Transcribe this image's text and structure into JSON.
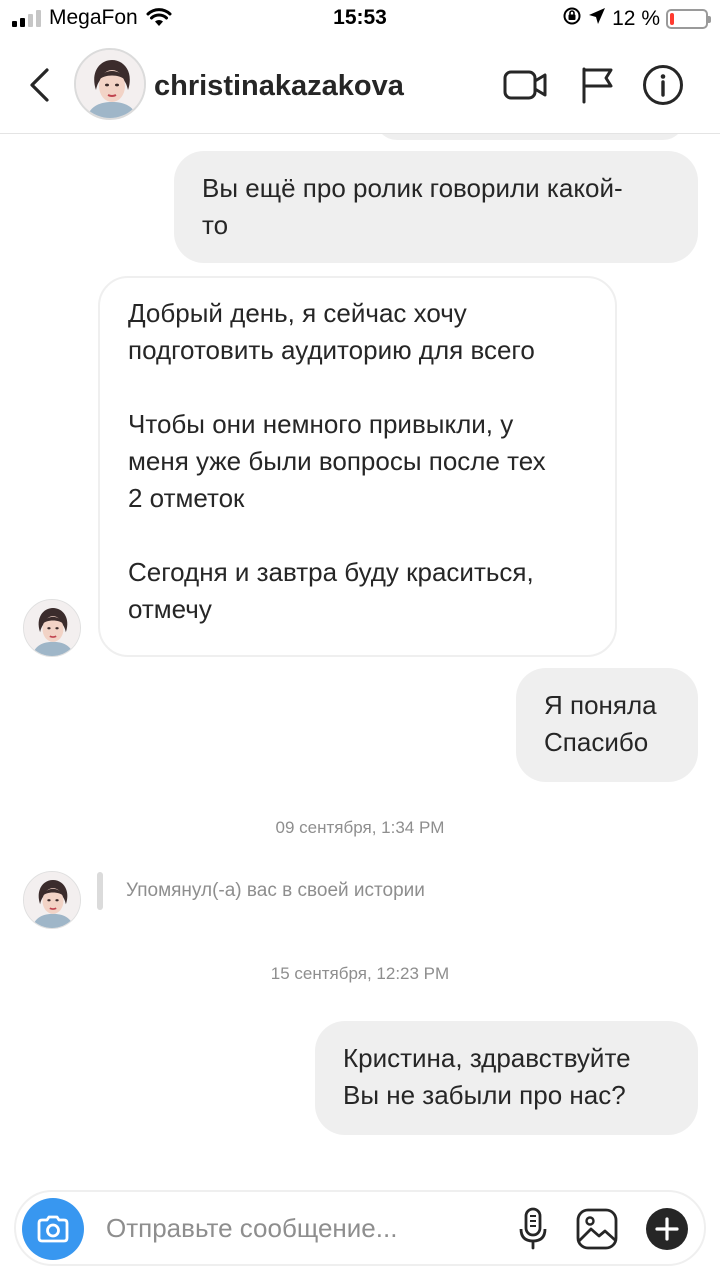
{
  "status_bar": {
    "carrier": "MegaFon",
    "time": "15:53",
    "battery_percent": "12 %",
    "battery_level": 0.12,
    "signal_bars": 2,
    "battery_color": "#ff3b30"
  },
  "header": {
    "username": "christinakazakova",
    "back_icon": "chevron-left-icon",
    "video_icon": "video-camera-icon",
    "flag_icon": "flag-icon",
    "info_icon": "info-icon"
  },
  "messages": {
    "m1_line1": "Вы ещё про ролик говорили какой-",
    "m1_line2": "то",
    "m2_p1_line1": "Добрый день, я сейчас хочу",
    "m2_p1_line2": "подготовить аудиторию для всего",
    "m2_p2_line1": "Чтобы они немного привыкли, у",
    "m2_p2_line2": "меня уже были вопросы после тех",
    "m2_p2_line3": "2 отметок",
    "m2_p3_line1": "Сегодня и завтра буду краситься,",
    "m2_p3_line2": "отмечу",
    "m3_line1": "Я поняла",
    "m3_line2": "Спасибо",
    "timestamp1": "09 сентября, 1:34 PM",
    "mention": "Упомянул(-а) вас в своей истории",
    "timestamp2": "15 сентября, 12:23 PM",
    "m4_line1": "Кристина, здравствуйте",
    "m4_line2": "Вы не забыли про нас?"
  },
  "composer": {
    "placeholder": "Отправьте сообщение...",
    "camera_icon": "camera-icon",
    "mic_icon": "microphone-icon",
    "gallery_icon": "image-icon",
    "plus_icon": "plus-icon",
    "accent_color": "#3897f0"
  },
  "colors": {
    "outgoing_bubble": "#efefef",
    "text": "#262626",
    "muted": "#8e8e8e"
  }
}
